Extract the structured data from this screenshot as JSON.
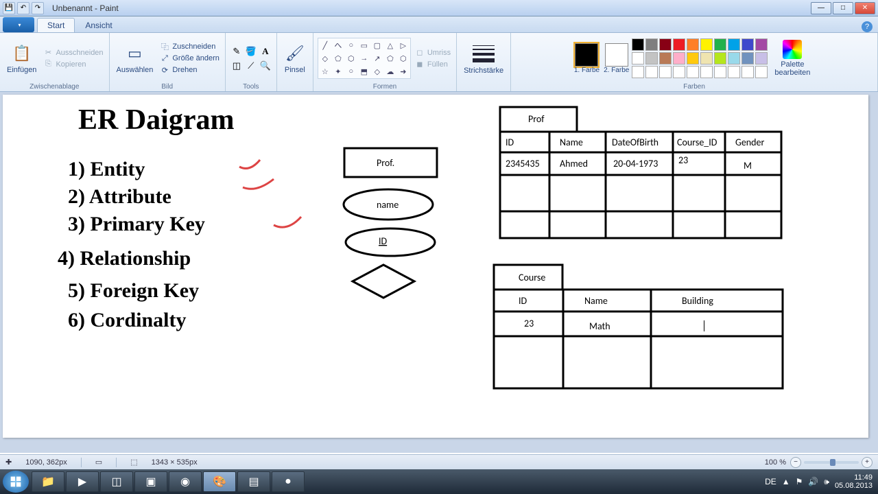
{
  "titlebar": {
    "title": "Unbenannt - Paint"
  },
  "tabs": {
    "start": "Start",
    "ansicht": "Ansicht"
  },
  "ribbon": {
    "clipboard": {
      "label": "Zwischenablage",
      "paste": "Einfügen",
      "cut": "Ausschneiden",
      "copy": "Kopieren"
    },
    "image": {
      "label": "Bild",
      "select": "Auswählen",
      "crop": "Zuschneiden",
      "resize": "Größe ändern",
      "rotate": "Drehen"
    },
    "tools": {
      "label": "Tools",
      "items": [
        "✎",
        "🪣",
        "A",
        "◢",
        "✎",
        "🔍"
      ]
    },
    "brush": {
      "label": "Pinsel"
    },
    "shapes": {
      "label": "Formen",
      "outline": "Umriss",
      "fill": "Füllen",
      "items": [
        "╱",
        "へ",
        "○",
        "▭",
        "▢",
        "△",
        "▷",
        "◇",
        "⬠",
        "⬡",
        "→",
        "↗",
        "⬠",
        "⬡",
        "☆",
        "✦",
        "○",
        "⬒",
        "◇",
        "☁",
        "➜"
      ]
    },
    "stroke": {
      "label": "Strichstärke"
    },
    "colors": {
      "label": "Farben",
      "color1": "1. Farbe",
      "color2": "2. Farbe",
      "edit": "Palette bearbeiten",
      "palette": [
        "#000000",
        "#7f7f7f",
        "#880015",
        "#ed1c24",
        "#ff7f27",
        "#fff200",
        "#22b14c",
        "#00a2e8",
        "#3f48cc",
        "#a349a4",
        "#ffffff",
        "#c3c3c3",
        "#b97a57",
        "#ffaec9",
        "#ffc90e",
        "#efe4b0",
        "#b5e61d",
        "#99d9ea",
        "#7092be",
        "#c8bfe7"
      ]
    }
  },
  "canvas": {
    "title": "ER Daigram",
    "items": [
      "1) Entity",
      "2) Attribute",
      "3) Primary Key",
      "4) Relationship",
      "5) Foreign Key",
      "6) Cordinalty"
    ],
    "shapes": {
      "prof": "Prof.",
      "name": "name",
      "id": "ID"
    },
    "prof_table": {
      "title": "Prof",
      "headers": [
        "ID",
        "Name",
        "DateOfBirth",
        "Course_ID",
        "Gender"
      ],
      "row": [
        "2345435",
        "Ahmed",
        "20-04-1973",
        "23",
        "M"
      ]
    },
    "course_table": {
      "title": "Course",
      "headers": [
        "ID",
        "Name",
        "Building"
      ],
      "row": [
        "23",
        "Math",
        ""
      ]
    }
  },
  "status": {
    "pos": "1090, 362px",
    "size": "1343 × 535px",
    "zoom": "100 %"
  },
  "tray": {
    "lang": "DE",
    "time": "11:49",
    "date": "05.08.2013"
  },
  "chart_data": {
    "type": "table",
    "tables": [
      {
        "name": "Prof",
        "columns": [
          "ID",
          "Name",
          "DateOfBirth",
          "Course_ID",
          "Gender"
        ],
        "rows": [
          [
            "2345435",
            "Ahmed",
            "20-04-1973",
            "23",
            "M"
          ]
        ]
      },
      {
        "name": "Course",
        "columns": [
          "ID",
          "Name",
          "Building"
        ],
        "rows": [
          [
            "23",
            "Math",
            ""
          ]
        ]
      }
    ]
  }
}
